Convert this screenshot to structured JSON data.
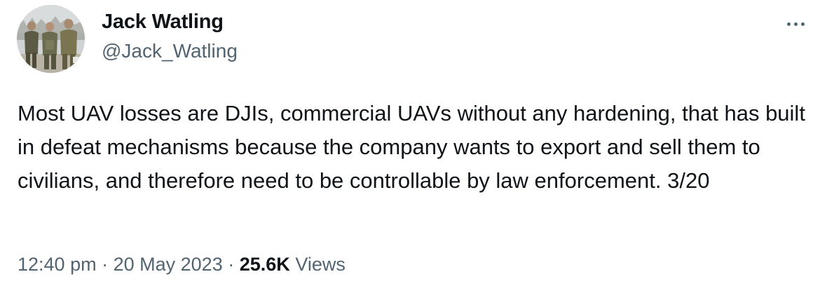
{
  "author": {
    "display_name": "Jack Watling",
    "handle": "@Jack_Watling",
    "avatar_icon": "profile-photo-soldiers"
  },
  "more_icon": "more-horizontal-icon",
  "tweet": {
    "text": "Most UAV losses are DJIs, commercial UAVs without any hardening, that has built in defeat mechanisms because the company wants to export and sell them to civilians, and therefore need to be controllable by law enforcement. 3/20"
  },
  "meta": {
    "time": "12:40 pm",
    "separator": "·",
    "date": "20 May 2023",
    "views_count": "25.6K",
    "views_label": "Views"
  },
  "colors": {
    "text": "#0f1419",
    "secondary": "#536471",
    "background": "#ffffff"
  }
}
